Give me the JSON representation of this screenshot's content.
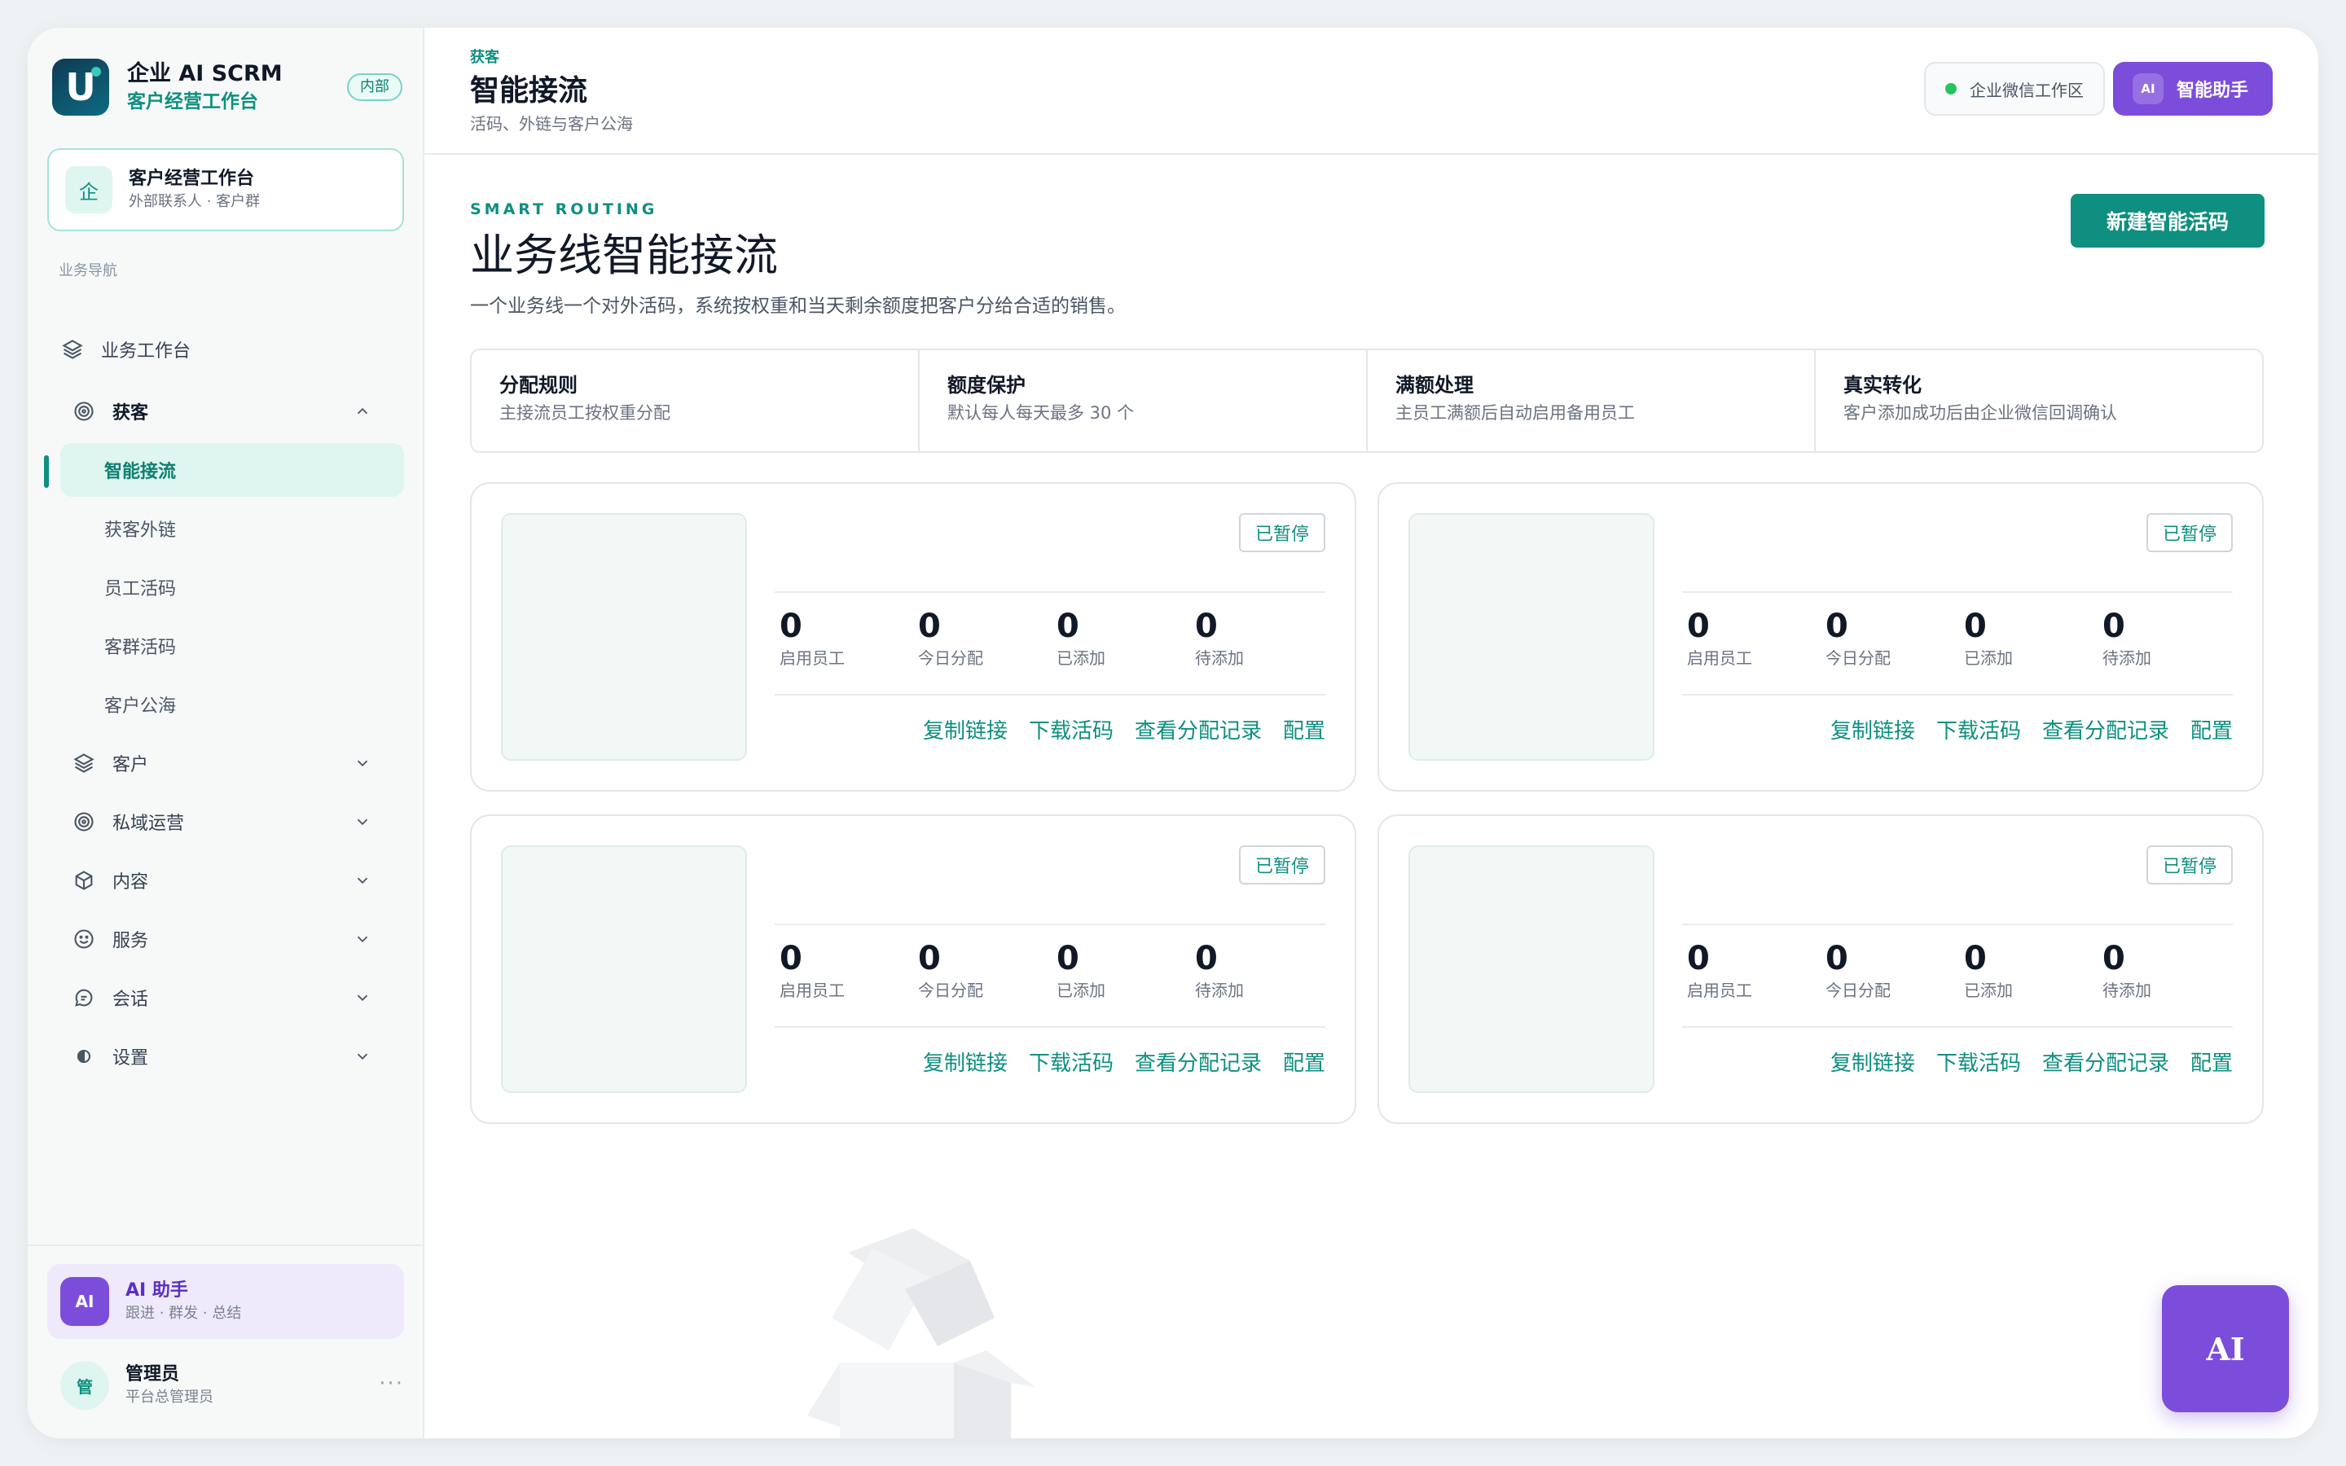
{
  "brand": {
    "name": "企业 AI SCRM",
    "subtitle": "客户经营工作台",
    "badge": "内部"
  },
  "workspace": {
    "icon_char": "企",
    "title": "客户经营工作台",
    "subtitle": "外部联系人 · 客户群"
  },
  "nav": {
    "caption": "业务导航",
    "workbench": "业务工作台",
    "acquisition": {
      "label": "获客",
      "items": [
        "智能接流",
        "获客外链",
        "员工活码",
        "客群活码",
        "客户公海"
      ],
      "active": "智能接流"
    },
    "groups": [
      "客户",
      "私域运营",
      "内容",
      "服务",
      "会话",
      "设置"
    ]
  },
  "assistant_card": {
    "avatar": "AI",
    "title": "AI 助手",
    "subtitle": "跟进 · 群发 · 总结"
  },
  "user": {
    "avatar": "管",
    "name": "管理员",
    "role": "平台总管理员",
    "more": "···"
  },
  "header": {
    "breadcrumb": "获客",
    "title": "智能接流",
    "subtitle": "活码、外链与客户公海",
    "env_label": "企业微信工作区",
    "ai_button": {
      "mini": "AI",
      "label": "智能助手"
    }
  },
  "hero": {
    "eyebrow": "SMART ROUTING",
    "title": "业务线智能接流",
    "subtitle": "一个业务线一个对外活码，系统按权重和当天剩余额度把客户分给合适的销售。",
    "create_button": "新建智能活码"
  },
  "rules": [
    {
      "title": "分配规则",
      "desc": "主接流员工按权重分配"
    },
    {
      "title": "额度保护",
      "desc": "默认每人每天最多 30 个"
    },
    {
      "title": "满额处理",
      "desc": "主员工满额后自动启用备用员工"
    },
    {
      "title": "真实转化",
      "desc": "客户添加成功后由企业微信回调确认"
    }
  ],
  "cards": [
    {
      "status": "已暂停",
      "stats": [
        {
          "value": "0",
          "label": "启用员工"
        },
        {
          "value": "0",
          "label": "今日分配"
        },
        {
          "value": "0",
          "label": "已添加"
        },
        {
          "value": "0",
          "label": "待添加"
        }
      ],
      "actions": [
        "复制链接",
        "下载活码",
        "查看分配记录",
        "配置"
      ]
    },
    {
      "status": "已暂停",
      "stats": [
        {
          "value": "0",
          "label": "启用员工"
        },
        {
          "value": "0",
          "label": "今日分配"
        },
        {
          "value": "0",
          "label": "已添加"
        },
        {
          "value": "0",
          "label": "待添加"
        }
      ],
      "actions": [
        "复制链接",
        "下载活码",
        "查看分配记录",
        "配置"
      ]
    },
    {
      "status": "已暂停",
      "stats": [
        {
          "value": "0",
          "label": "启用员工"
        },
        {
          "value": "0",
          "label": "今日分配"
        },
        {
          "value": "0",
          "label": "已添加"
        },
        {
          "value": "0",
          "label": "待添加"
        }
      ],
      "actions": [
        "复制链接",
        "下载活码",
        "查看分配记录",
        "配置"
      ]
    },
    {
      "status": "已暂停",
      "stats": [
        {
          "value": "0",
          "label": "启用员工"
        },
        {
          "value": "0",
          "label": "今日分配"
        },
        {
          "value": "0",
          "label": "已添加"
        },
        {
          "value": "0",
          "label": "待添加"
        }
      ],
      "actions": [
        "复制链接",
        "下载活码",
        "查看分配记录",
        "配置"
      ]
    }
  ],
  "fab_label": "AI",
  "colors": {
    "accent": "#0e8f80",
    "ai_purple": "#7c4ddb",
    "active_bg": "#dff5f0"
  }
}
